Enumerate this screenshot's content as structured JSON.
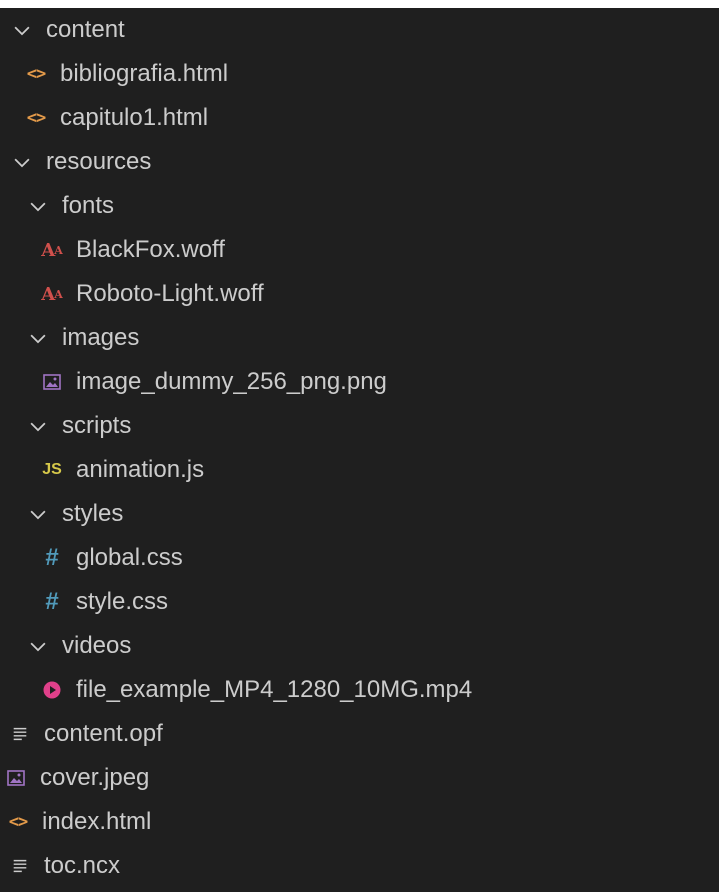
{
  "explorer": {
    "accent": {
      "html": "#e39a4a",
      "font": "#d0504c",
      "image": "#a074c4",
      "js": "#d6c84a",
      "css": "#519aba",
      "video": "#e0408a",
      "text": "#cccccc",
      "background": "#1f1f1f"
    },
    "items": [
      {
        "label": "content",
        "icon": "chevron-down-icon",
        "kind": "folder"
      },
      {
        "label": "bibliografia.html",
        "icon": "html-file-icon",
        "kind": "file"
      },
      {
        "label": "capitulo1.html",
        "icon": "html-file-icon",
        "kind": "file"
      },
      {
        "label": "resources",
        "icon": "chevron-down-icon",
        "kind": "folder"
      },
      {
        "label": "fonts",
        "icon": "chevron-down-icon",
        "kind": "folder"
      },
      {
        "label": "BlackFox.woff",
        "icon": "font-file-icon",
        "kind": "file"
      },
      {
        "label": "Roboto-Light.woff",
        "icon": "font-file-icon",
        "kind": "file"
      },
      {
        "label": "images",
        "icon": "chevron-down-icon",
        "kind": "folder"
      },
      {
        "label": "image_dummy_256_png.png",
        "icon": "image-file-icon",
        "kind": "file"
      },
      {
        "label": "scripts",
        "icon": "chevron-down-icon",
        "kind": "folder"
      },
      {
        "label": "animation.js",
        "icon": "js-file-icon",
        "kind": "file"
      },
      {
        "label": "styles",
        "icon": "chevron-down-icon",
        "kind": "folder"
      },
      {
        "label": "global.css",
        "icon": "css-file-icon",
        "kind": "file"
      },
      {
        "label": "style.css",
        "icon": "css-file-icon",
        "kind": "file"
      },
      {
        "label": "videos",
        "icon": "chevron-down-icon",
        "kind": "folder"
      },
      {
        "label": "file_example_MP4_1280_10MG.mp4",
        "icon": "video-file-icon",
        "kind": "file"
      },
      {
        "label": "content.opf",
        "icon": "text-file-icon",
        "kind": "file"
      },
      {
        "label": "cover.jpeg",
        "icon": "image-file-icon",
        "kind": "file"
      },
      {
        "label": "index.html",
        "icon": "html-file-icon",
        "kind": "file"
      },
      {
        "label": "toc.ncx",
        "icon": "text-file-icon",
        "kind": "file"
      }
    ]
  }
}
